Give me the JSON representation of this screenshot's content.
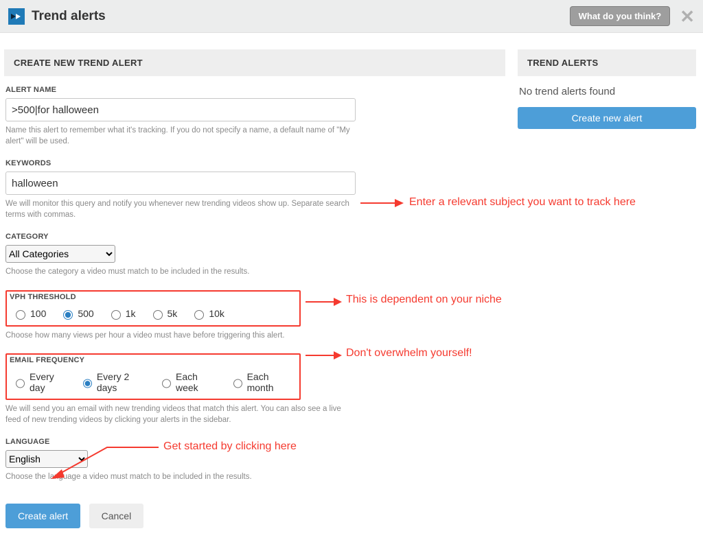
{
  "topbar": {
    "title": "Trend alerts",
    "feedback_label": "What do you think?"
  },
  "create": {
    "header": "CREATE NEW TREND ALERT",
    "alert_name": {
      "label": "ALERT NAME",
      "value": ">500|for halloween",
      "help": "Name this alert to remember what it's tracking. If you do not specify a name, a default name of \"My alert\" will be used."
    },
    "keywords": {
      "label": "KEYWORDS",
      "value": "halloween",
      "help": "We will monitor this query and notify you whenever new trending videos show up. Separate search terms with commas."
    },
    "category": {
      "label": "CATEGORY",
      "selected": "All Categories",
      "help": "Choose the category a video must match to be included in the results."
    },
    "vph": {
      "label": "VPH THRESHOLD",
      "options": [
        "100",
        "500",
        "1k",
        "5k",
        "10k"
      ],
      "selected": "500",
      "help": "Choose how many views per hour a video must have before triggering this alert."
    },
    "email_freq": {
      "label": "EMAIL FREQUENCY",
      "options": [
        "Every day",
        "Every 2 days",
        "Each week",
        "Each month"
      ],
      "selected": "Every 2 days",
      "help": "We will send you an email with new trending videos that match this alert. You can also see a live feed of new trending videos by clicking your alerts in the sidebar."
    },
    "language": {
      "label": "LANGUAGE",
      "selected": "English",
      "help": "Choose the language a video must match to be included in the results."
    },
    "submit_label": "Create alert",
    "cancel_label": "Cancel"
  },
  "sidebar": {
    "header": "TREND ALERTS",
    "empty_text": "No trend alerts found",
    "new_label": "Create new alert"
  },
  "annotations": {
    "keywords": "Enter a relevant subject you want to track here",
    "vph": "This is dependent on your niche",
    "email": "Don't overwhelm yourself!",
    "cta": "Get started by clicking here"
  }
}
